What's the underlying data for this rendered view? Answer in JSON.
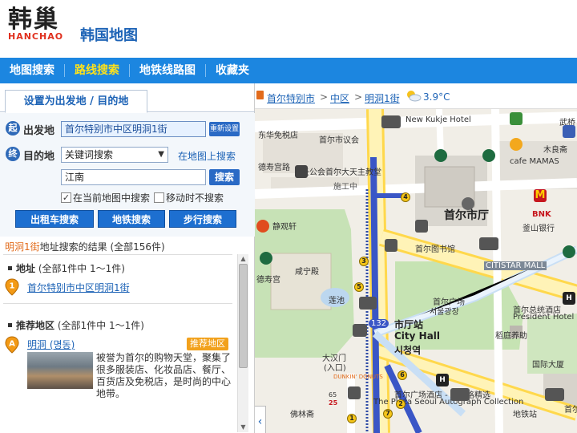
{
  "header": {
    "logo_cn": "韩巢",
    "logo_en": "HANCHAO",
    "site_title": "韩国地图"
  },
  "nav": {
    "items": [
      {
        "label": "地图搜索",
        "active": false
      },
      {
        "label": "路线搜索",
        "active": true
      },
      {
        "label": "地铁线路图",
        "active": false
      },
      {
        "label": "收藏夹",
        "active": false
      }
    ]
  },
  "left": {
    "tab_label": "设置为出发地 / 目的地",
    "start": {
      "badge": "起",
      "label": "出发地",
      "value": "首尔特别市中区明洞1街",
      "reset_label": "重新设置"
    },
    "dest": {
      "badge": "终",
      "label": "目的地",
      "select_value": "关键词搜索",
      "map_link": "在地图上搜索",
      "keyword_value": "江南",
      "search_label": "搜索"
    },
    "options": {
      "current_map": "在当前地图中搜索",
      "no_search_on_move": "移动时不搜索"
    },
    "actions": {
      "taxi": "出租车搜索",
      "subway": "地铁搜索",
      "walk": "步行搜索"
    },
    "results": {
      "keyword": "明洞1街",
      "summary_rest": "地址搜索的结果 (全部156件)",
      "address": {
        "title": "地址",
        "count": "(全部1件中 1～1件)",
        "marker": "1",
        "item": "首尔特别市中区明洞1街"
      },
      "recommend": {
        "title": "推荐地区",
        "count": "(全部1件中 1～1件)",
        "marker": "A",
        "name": "明洞 (명동)",
        "tag": "推荐地区",
        "desc": "被誉为首尔的购物天堂，聚集了很多服装店、化妆品店、餐厅、百货店及免税店，是时尚的中心地带。"
      }
    }
  },
  "map": {
    "breadcrumb": [
      "首尔特别市",
      "中区",
      "明洞1街"
    ],
    "temperature": "3.9°C",
    "labels": {
      "new_kukje": "New Kukje Hotel",
      "seoul_council": "首尔市议会",
      "dongwha": "东华免税店",
      "deoksu_road": "德寿宫路",
      "cathedral": "圣公会首尔大天主教堂",
      "construction": "施工中",
      "city_hall": "首尔市厅",
      "jingguanxuan": "静观轩",
      "library": "首尔图书馆",
      "citistar": "CITISTAR MALL",
      "deoksugung": "德寿宫",
      "hamnyeong": "咸宁殿",
      "pond": "莲池",
      "line_no": "132",
      "station_cn": "市厅站",
      "station_en": "City Hall",
      "station_ko": "시청역",
      "plaza_cn": "首尔广场",
      "plaza_ko": "서울광장",
      "daehanmun": "大汉门",
      "entrance": "(入口)",
      "plaza_hotel": "首尔广场酒店 - 傲途格精选",
      "plaza_hotel_en": "The Plaza Seoul Autograph Collection",
      "president_hotel_cn": "首尔总统酒店",
      "president_hotel_en": "President Hotel",
      "ginza": "稻庭养助",
      "international_building": "国际大厦",
      "mugyo": "武桥",
      "kimu": "木良斋",
      "cafe_mamas": "cafe MAMAS",
      "bnk_logo": "BNK",
      "bnk": "釜山银行",
      "seongmyeong": "佛林斋",
      "station_nearby": "地铁站",
      "sungnyemun": "首尔市厅",
      "mugyo2": "武桥",
      "exit_label": "首尔威",
      "num_65": "65",
      "num_25": "25",
      "dunkin": "DUNKIN' DONUTS",
      "mcd": "M",
      "hotel_h": "H",
      "exits": [
        "1",
        "2",
        "3",
        "4",
        "5",
        "6",
        "7"
      ]
    }
  }
}
